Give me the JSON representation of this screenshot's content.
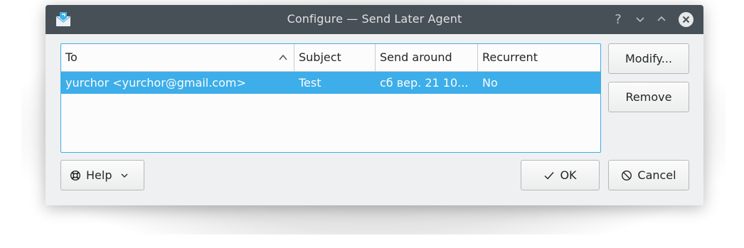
{
  "window": {
    "title": "Configure — Send Later Agent",
    "buttons": [
      "help-icon",
      "minimize-icon",
      "maximize-icon",
      "close-icon"
    ]
  },
  "table": {
    "columns": [
      "To",
      "Subject",
      "Send around",
      "Recurrent"
    ],
    "sort_column": "To",
    "sort_order": "ascending",
    "rows": [
      {
        "to": "yurchor <yurchor@gmail.com>",
        "subject": "Test",
        "send_around": "сб вер. 21 10...",
        "recurrent": "No",
        "selected": true
      }
    ]
  },
  "side_buttons": {
    "modify": "Modify...",
    "remove": "Remove"
  },
  "footer": {
    "help": "Help",
    "ok": "OK",
    "cancel": "Cancel"
  },
  "colors": {
    "titlebar": "#475057",
    "selection": "#3daee9",
    "window_bg": "#eff0f1"
  }
}
